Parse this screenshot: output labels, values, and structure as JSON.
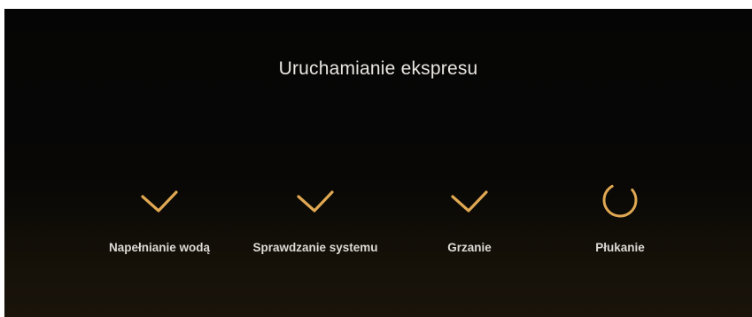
{
  "screen": {
    "title": "Uruchamianie ekspresu"
  },
  "accent_color": "#e0a852",
  "steps": [
    {
      "label": "Napełnianie wodą",
      "status": "done",
      "icon": "checkmark-icon"
    },
    {
      "label": "Sprawdzanie systemu",
      "status": "done",
      "icon": "checkmark-icon"
    },
    {
      "label": "Grzanie",
      "status": "done",
      "icon": "checkmark-icon"
    },
    {
      "label": "Płukanie",
      "status": "in-progress",
      "icon": "spinner-icon"
    }
  ]
}
